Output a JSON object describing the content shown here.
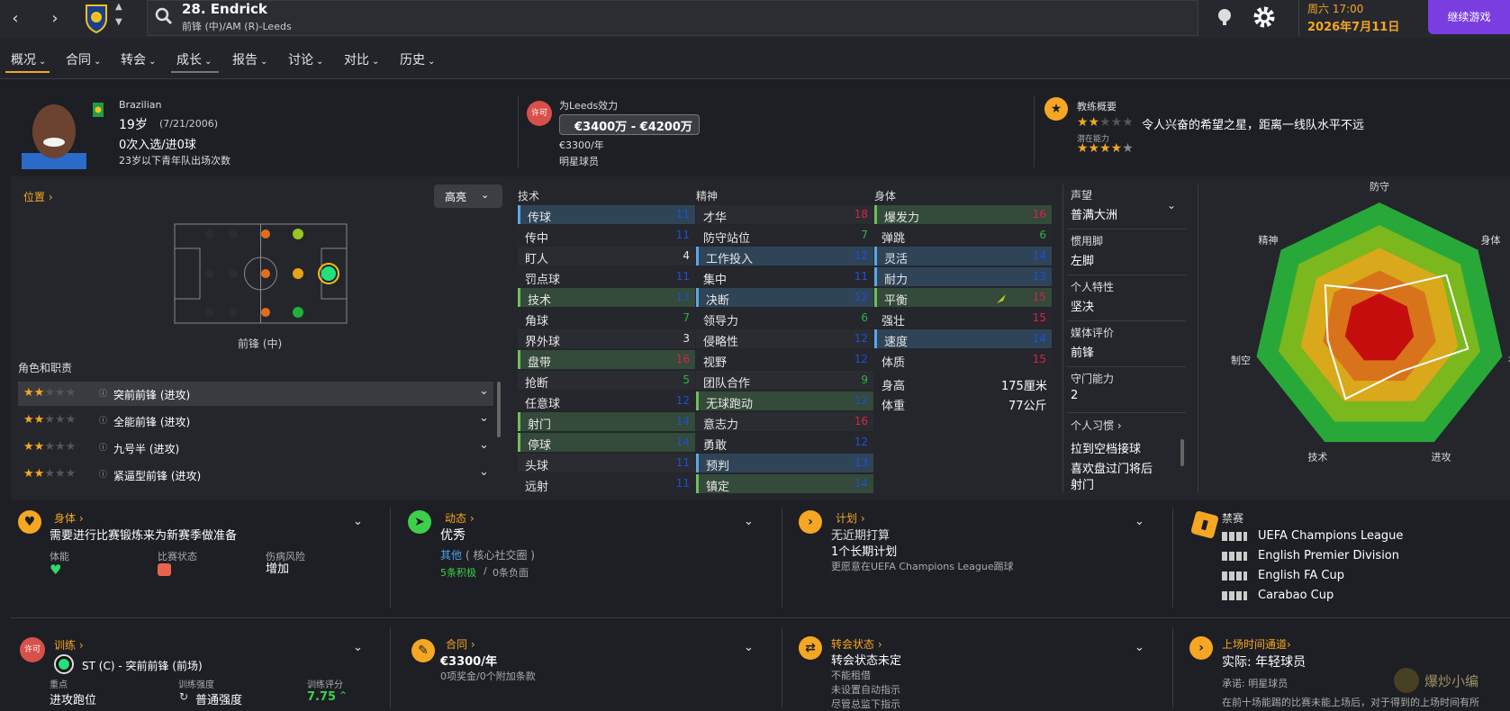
{
  "header": {
    "player_title": "28. Endrick",
    "player_subtitle": "前锋 (中)/AM (R)-Leeds",
    "day_time": "周六 17:00",
    "date": "2026年7月11日",
    "continue_label": "继续游戏"
  },
  "tabs": [
    {
      "label": "概况"
    },
    {
      "label": "合同"
    },
    {
      "label": "转会"
    },
    {
      "label": "成长"
    },
    {
      "label": "报告"
    },
    {
      "label": "讨论"
    },
    {
      "label": "对比"
    },
    {
      "label": "历史"
    }
  ],
  "profile": {
    "nationality": "Brazilian",
    "age": "19岁",
    "dob": "(7/21/2006)",
    "caps": "0次入选/进0球",
    "youth_apps": "23岁以下青年队出场次数"
  },
  "contract_top": {
    "playing_for": "为Leeds效力",
    "permit_badge": "许可",
    "value_range": "€3400万 - €4200万",
    "wage": "€3300/年",
    "status": "明星球员"
  },
  "coach": {
    "title": "教练概要",
    "current_stars": 2,
    "summary": "令人兴奋的希望之星，距离一线队水平不远",
    "potential_label": "潜在能力",
    "potential_stars": 4.5
  },
  "position": {
    "title": "位置",
    "highlight_label": "高亮",
    "position_name": "前锋 (中)"
  },
  "roles": {
    "title": "角色和职责",
    "items": [
      {
        "label": "突前前锋 (进攻)",
        "stars": 2
      },
      {
        "label": "全能前锋 (进攻)",
        "stars": 2
      },
      {
        "label": "九号半 (进攻)",
        "stars": 2
      },
      {
        "label": "紧逼型前锋 (进攻)",
        "stars": 2
      }
    ]
  },
  "attr_colors": {
    "blue": "#1e4fd8",
    "green": "#2fb24a",
    "red": "#d8234a",
    "gray": "#e6e6e6"
  },
  "technical": {
    "title": "技术",
    "items": [
      {
        "n": "传球",
        "v": "11",
        "c": "blue",
        "h": "blue"
      },
      {
        "n": "传中",
        "v": "11",
        "c": "blue",
        "h": ""
      },
      {
        "n": "盯人",
        "v": "4",
        "c": "gray",
        "h": ""
      },
      {
        "n": "罚点球",
        "v": "11",
        "c": "blue",
        "h": ""
      },
      {
        "n": "技术",
        "v": "13",
        "c": "blue",
        "h": "green"
      },
      {
        "n": "角球",
        "v": "7",
        "c": "green",
        "h": ""
      },
      {
        "n": "界外球",
        "v": "3",
        "c": "gray",
        "h": ""
      },
      {
        "n": "盘带",
        "v": "16",
        "c": "red",
        "h": "green"
      },
      {
        "n": "抢断",
        "v": "5",
        "c": "green",
        "h": ""
      },
      {
        "n": "任意球",
        "v": "12",
        "c": "blue",
        "h": ""
      },
      {
        "n": "射门",
        "v": "14",
        "c": "blue",
        "h": "green"
      },
      {
        "n": "停球",
        "v": "14",
        "c": "blue",
        "h": "green"
      },
      {
        "n": "头球",
        "v": "11",
        "c": "blue",
        "h": ""
      },
      {
        "n": "远射",
        "v": "11",
        "c": "blue",
        "h": ""
      }
    ]
  },
  "mental": {
    "title": "精神",
    "items": [
      {
        "n": "才华",
        "v": "18",
        "c": "red",
        "h": ""
      },
      {
        "n": "防守站位",
        "v": "7",
        "c": "green",
        "h": ""
      },
      {
        "n": "工作投入",
        "v": "12",
        "c": "blue",
        "h": "blue"
      },
      {
        "n": "集中",
        "v": "11",
        "c": "blue",
        "h": ""
      },
      {
        "n": "决断",
        "v": "12",
        "c": "blue",
        "h": "blue"
      },
      {
        "n": "领导力",
        "v": "6",
        "c": "green",
        "h": ""
      },
      {
        "n": "侵略性",
        "v": "12",
        "c": "blue",
        "h": ""
      },
      {
        "n": "视野",
        "v": "12",
        "c": "blue",
        "h": ""
      },
      {
        "n": "团队合作",
        "v": "9",
        "c": "green",
        "h": ""
      },
      {
        "n": "无球跑动",
        "v": "12",
        "c": "blue",
        "h": "green"
      },
      {
        "n": "意志力",
        "v": "16",
        "c": "red",
        "h": ""
      },
      {
        "n": "勇敢",
        "v": "12",
        "c": "blue",
        "h": ""
      },
      {
        "n": "预判",
        "v": "13",
        "c": "blue",
        "h": "blue"
      },
      {
        "n": "镇定",
        "v": "14",
        "c": "blue",
        "h": "green"
      }
    ]
  },
  "physical": {
    "title": "身体",
    "items": [
      {
        "n": "爆发力",
        "v": "16",
        "c": "red",
        "h": "green"
      },
      {
        "n": "弹跳",
        "v": "6",
        "c": "green",
        "h": ""
      },
      {
        "n": "灵活",
        "v": "14",
        "c": "blue",
        "h": "blue"
      },
      {
        "n": "耐力",
        "v": "13",
        "c": "blue",
        "h": "blue"
      },
      {
        "n": "平衡",
        "v": "15",
        "c": "red",
        "h": "green"
      },
      {
        "n": "强壮",
        "v": "15",
        "c": "red",
        "h": ""
      },
      {
        "n": "速度",
        "v": "14",
        "c": "blue",
        "h": "blue"
      },
      {
        "n": "体质",
        "v": "15",
        "c": "red",
        "h": ""
      }
    ],
    "height_label": "身高",
    "height": "175厘米",
    "weight_label": "体重",
    "weight": "77公斤"
  },
  "info": {
    "items": [
      {
        "label": "声望",
        "value": "普满大洲"
      },
      {
        "label": "惯用脚",
        "value": "左脚"
      },
      {
        "label": "个人特性",
        "value": "坚决"
      },
      {
        "label": "媒体评价",
        "value": "前锋"
      },
      {
        "label": "守门能力",
        "value": "2"
      }
    ],
    "habits_title": "个人习惯",
    "habits": [
      "拉到空档接球",
      "喜欢盘过门将后",
      "射门"
    ]
  },
  "radar": {
    "labels": [
      "防守",
      "身体",
      "视野",
      "进攻",
      "技术",
      "制空",
      "精神"
    ]
  },
  "cards": {
    "fitness": {
      "title": "身体",
      "text": "需要进行比赛锻炼来为新赛季做准备",
      "sub1": "体能",
      "sub2": "比赛状态",
      "sub3": "伤病风险",
      "sub3_value": "增加"
    },
    "morale": {
      "title": "动态",
      "value": "优秀",
      "link": "其他",
      "link_detail": "( 核心社交圈 )",
      "positive": "5条积极",
      "divider": "/",
      "negative": "0条负面"
    },
    "plan": {
      "title": "计划",
      "line1": "无近期打算",
      "line2": "1个长期计划",
      "line3": "更愿意在UEFA Champions League踢球"
    },
    "bans": {
      "title": "禁赛",
      "items": [
        "UEFA Champions League",
        "English Premier Division",
        "English FA Cup",
        "Carabao Cup"
      ]
    },
    "training": {
      "title": "训练",
      "badge": "许可",
      "role": "ST (C) - 突前前锋 (前场)",
      "focus_label": "重点",
      "focus_value": "进攻跑位",
      "intensity_label": "训练强度",
      "intensity_value": "普通强度",
      "rating_label": "训练评分",
      "rating_value": "7.75"
    },
    "contract": {
      "title": "合同",
      "wage": "€3300/年",
      "detail": "0项奖金/0个附加条款"
    },
    "transfer": {
      "title": "转会状态",
      "value": "转会状态未定",
      "line1": "不能租借",
      "line2": "未设置自动指示",
      "line3": "尽管总监下指示"
    },
    "pathway": {
      "title": "上场时间通道",
      "value": "实际: 年轻球员",
      "promise": "承诺: 明星球员",
      "desc": "在前十场能踢的比赛未能上场后，对于得到的上场时间有所"
    }
  },
  "watermark": "爆炒小编"
}
